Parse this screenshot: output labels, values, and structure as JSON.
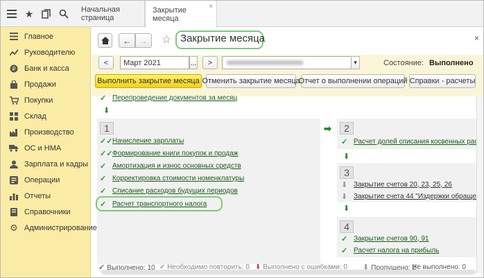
{
  "tabs": [
    {
      "label": "Начальная страница"
    },
    {
      "label": "Закрытие месяца",
      "close": "×"
    }
  ],
  "sidebar": {
    "items": [
      {
        "label": "Главное",
        "icon": "list-icon"
      },
      {
        "label": "Руководителю",
        "icon": "chart-line-icon"
      },
      {
        "label": "Банк и касса",
        "icon": "bank-icon"
      },
      {
        "label": "Продажи",
        "icon": "bag-icon"
      },
      {
        "label": "Покупки",
        "icon": "cart-icon"
      },
      {
        "label": "Склад",
        "icon": "warehouse-icon"
      },
      {
        "label": "Производство",
        "icon": "factory-icon"
      },
      {
        "label": "ОС и НМА",
        "icon": "truck-icon"
      },
      {
        "label": "Зарплата и кадры",
        "icon": "people-icon"
      },
      {
        "label": "Операции",
        "icon": "operations-icon"
      },
      {
        "label": "Отчеты",
        "icon": "chart-bar-icon"
      },
      {
        "label": "Справочники",
        "icon": "book-icon"
      },
      {
        "label": "Администрирование",
        "icon": "gear-icon"
      }
    ]
  },
  "form": {
    "title": "Закрытие месяца",
    "close": "×",
    "period": {
      "prev": "<",
      "value": "Март 2021",
      "dots": "...",
      "next": ">"
    },
    "organization": {
      "value": "",
      "dropdown": "▾"
    },
    "state_label": "Состояние:",
    "state_value": "Выполнено",
    "buttons": {
      "run": "Выполнить закрытие месяца",
      "cancel": "Отменить закрытие месяца",
      "report": "Отчет о выполнении операций",
      "references": "Справки - расчеты"
    },
    "reposting": "Перепроведение документов за месяц",
    "step1": {
      "number": "1",
      "items": [
        "Начисление зарплаты",
        "Формирование книги покупок и продаж",
        "Амортизация и износ основных средств",
        "Корректировка стоимости номенклатуры",
        "Списание расходов будущих периодов",
        "Расчет транспортного налога"
      ]
    },
    "step2": {
      "number": "2",
      "items": [
        "Расчет долей списания косвенных расход"
      ]
    },
    "step3": {
      "number": "3",
      "items": [
        "Закрытие счетов 20, 23, 25, 26",
        "Закрытие счета 44 \"Издержки обращения\""
      ]
    },
    "step4": {
      "number": "4",
      "items": [
        "Закрытие счетов 90, 91",
        "Расчет налога на прибыль"
      ]
    },
    "status_bar": {
      "done": "Выполнено: 10",
      "need_repeat": "Необходимо повторить: 0",
      "errors": "Выполнено с ошибками: 0",
      "skipped": "Пропущено: 2",
      "not_done": "Не выполнено: 0"
    }
  }
}
